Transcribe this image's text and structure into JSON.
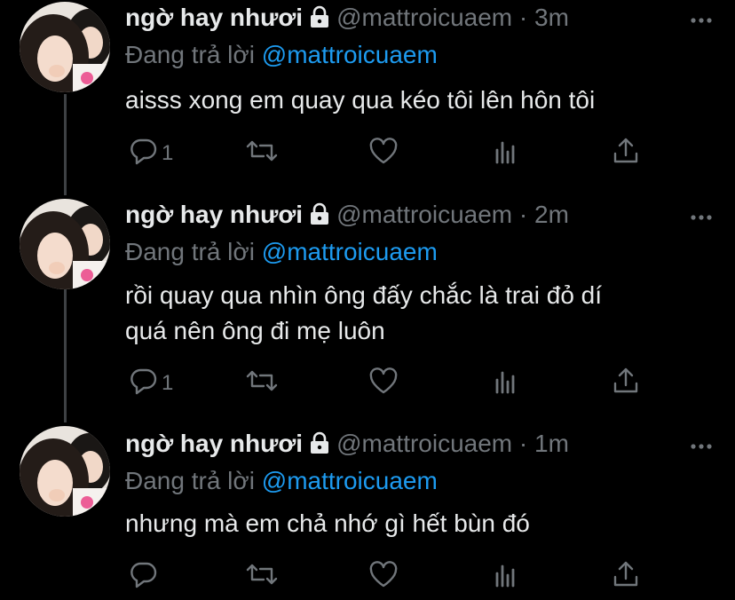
{
  "tweets": [
    {
      "name": "ngờ hay nhươi",
      "handle": "@mattroicuaem",
      "dot": "·",
      "time": "3m",
      "reply_prefix": "Đang trả lời",
      "reply_to": "@mattroicuaem",
      "text_lines": [
        "aisss xong em quay qua kéo tôi lên hôn tôi"
      ],
      "reply_count": "1"
    },
    {
      "name": "ngờ hay nhươi",
      "handle": "@mattroicuaem",
      "dot": "·",
      "time": "2m",
      "reply_prefix": "Đang trả lời",
      "reply_to": "@mattroicuaem",
      "text_lines": [
        "rồi quay qua nhìn ông đấy chắc là trai đỏ dí",
        "quá nên ông đi mẹ luôn"
      ],
      "reply_count": "1"
    },
    {
      "name": "ngờ hay nhươi",
      "handle": "@mattroicuaem",
      "dot": "·",
      "time": "1m",
      "reply_prefix": "Đang trả lời",
      "reply_to": "@mattroicuaem",
      "text_lines": [
        "nhưng mà em chả nhớ gì hết bùn đó"
      ],
      "reply_count": ""
    }
  ],
  "icons": [
    "lock-icon",
    "more-icon",
    "reply-icon",
    "retweet-icon",
    "like-icon",
    "analytics-icon",
    "share-icon"
  ],
  "colors": {
    "background": "#000000",
    "text": "#e7e9ea",
    "muted": "#71767b",
    "accent": "#1d9bf0"
  }
}
